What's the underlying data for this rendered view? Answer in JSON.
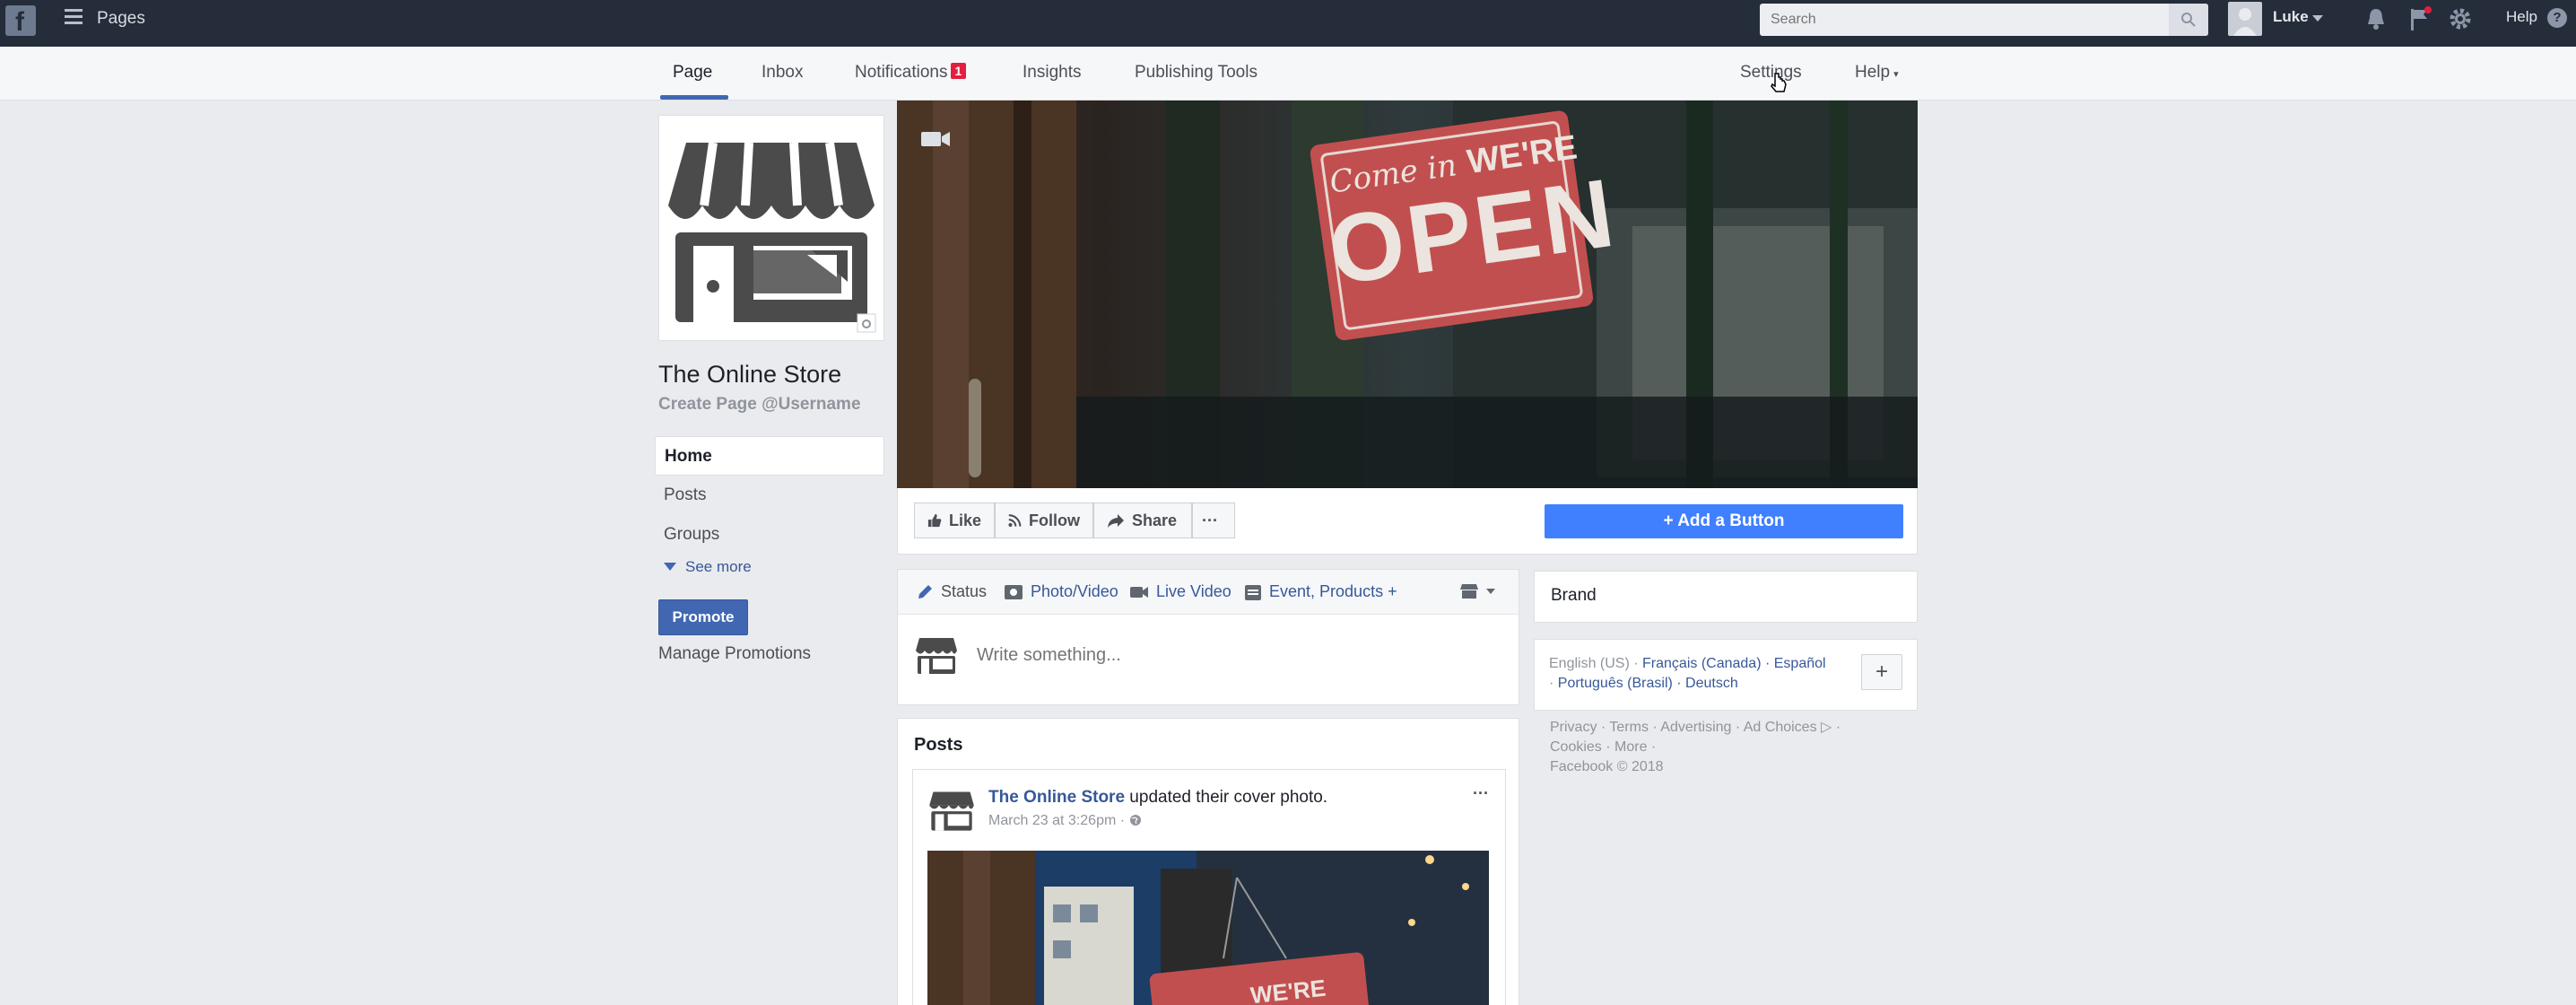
{
  "topbar": {
    "logo": "f",
    "title": "Pages",
    "search_placeholder": "Search",
    "user_name": "Luke",
    "help_label": "Help",
    "help_icon": "?"
  },
  "subnav": {
    "tabs": [
      {
        "label": "Page"
      },
      {
        "label": "Inbox"
      },
      {
        "label": "Notifications"
      },
      {
        "label": "Insights"
      },
      {
        "label": "Publishing Tools"
      }
    ],
    "notification_count": "1",
    "settings_label": "Settings",
    "help_label": "Help",
    "help_caret": "▾"
  },
  "profile": {
    "name": "The Online Store",
    "username_link": "Create Page @Username"
  },
  "left_nav": {
    "items": [
      {
        "label": "Home"
      },
      {
        "label": "Posts"
      },
      {
        "label": "Groups"
      }
    ],
    "see_more": "See more",
    "promote": "Promote",
    "manage_promotions": "Manage Promotions"
  },
  "cover": {
    "sign_script": "Come in",
    "sign_line1": "WE'RE",
    "sign_line2": "OPEN"
  },
  "actions": {
    "like": "Like",
    "follow": "Follow",
    "share": "Share",
    "more": "···",
    "add_button": "+ Add a Button"
  },
  "composer": {
    "tabs": [
      {
        "label": "Status"
      },
      {
        "label": "Photo/Video"
      },
      {
        "label": "Live Video"
      },
      {
        "label": "Event, Products +"
      }
    ],
    "placeholder": "Write something..."
  },
  "posts": {
    "title": "Posts",
    "post": {
      "author": "The Online Store",
      "action": " updated their cover photo.",
      "time": "March 23 at 3:26pm · ",
      "more": "···",
      "image_sign": "WE'RE"
    }
  },
  "right": {
    "brand": "Brand",
    "languages": {
      "current": "English (US) · ",
      "others_line1": "Français (Canada) · Español",
      "sep": "· ",
      "others_line2": "Português (Brasil) · Deutsch"
    },
    "add_language": "+",
    "footer_line1": "Privacy · Terms · Advertising · Ad Choices ▷ ·",
    "footer_line2": "Cookies · More ·",
    "copyright": "Facebook © 2018"
  },
  "colors": {
    "topbar_bg": "#252d3a",
    "accent_blue": "#4267b2",
    "add_button_blue": "#4080ff",
    "link_blue": "#365899",
    "sign_red": "#c24f4f",
    "badge_red": "#e41e3f"
  }
}
